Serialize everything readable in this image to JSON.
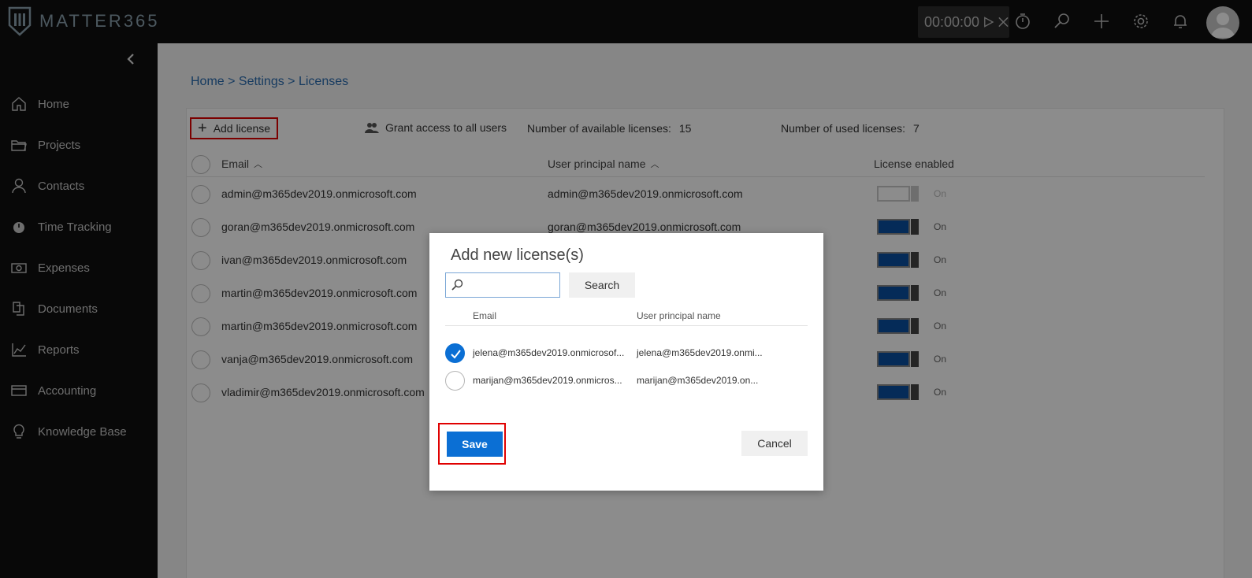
{
  "app": {
    "logo_text_a": "MATTER",
    "logo_text_b": "365",
    "timer": "00:00:00",
    "accent": "#0b6fd4"
  },
  "topbar_icons": [
    "play-icon",
    "close-icon",
    "stopwatch-icon",
    "search-icon",
    "plus-icon",
    "gear-icon",
    "bell-icon",
    "user-avatar"
  ],
  "sidebar": {
    "items": [
      {
        "label": "Home",
        "icon": "home-icon"
      },
      {
        "label": "Projects",
        "icon": "folder-icon"
      },
      {
        "label": "Contacts",
        "icon": "person-icon"
      },
      {
        "label": "Time Tracking",
        "icon": "stopwatch-icon"
      },
      {
        "label": "Expenses",
        "icon": "money-icon"
      },
      {
        "label": "Documents",
        "icon": "documents-icon"
      },
      {
        "label": "Reports",
        "icon": "chart-icon"
      },
      {
        "label": "Accounting",
        "icon": "card-icon"
      },
      {
        "label": "Knowledge Base",
        "icon": "lightbulb-icon"
      }
    ]
  },
  "breadcrumb": "Home > Settings > Licenses",
  "toolbar": {
    "add_license": "Add license",
    "grant_access": "Grant access to all users",
    "available_label": "Number of available licenses:",
    "available_value": "15",
    "used_label": "Number of used licenses:",
    "used_value": "7"
  },
  "table": {
    "columns": [
      "Email",
      "User principal name",
      "License enabled"
    ],
    "rows": [
      {
        "email": "admin@m365dev2019.onmicrosoft.com",
        "upn": "admin@m365dev2019.onmicrosoft.com",
        "enabled": "On"
      },
      {
        "email": "goran@m365dev2019.onmicrosoft.com",
        "upn": "goran@m365dev2019.onmicrosoft.com",
        "enabled": "On"
      },
      {
        "email": "ivan@m365dev2019.onmicrosoft.com",
        "upn": "",
        "enabled": "On"
      },
      {
        "email": "martin@m365dev2019.onmicrosoft.com",
        "upn": "",
        "enabled": "On"
      },
      {
        "email": "martin@m365dev2019.onmicrosoft.com",
        "upn": "",
        "enabled": "On"
      },
      {
        "email": "vanja@m365dev2019.onmicrosoft.com",
        "upn": "",
        "enabled": "On"
      },
      {
        "email": "vladimir@m365dev2019.onmicrosoft.com",
        "upn": "",
        "enabled": "On"
      }
    ]
  },
  "dialog": {
    "title": "Add new license(s)",
    "search_value": "",
    "search_button": "Search",
    "columns": [
      "Email",
      "User principal name"
    ],
    "rows": [
      {
        "email": "jelena@m365dev2019.onmicrosof...",
        "upn": "jelena@m365dev2019.onmi...",
        "checked": true
      },
      {
        "email": "marijan@m365dev2019.onmicros...",
        "upn": "marijan@m365dev2019.on...",
        "checked": false
      }
    ],
    "save": "Save",
    "cancel": "Cancel"
  }
}
